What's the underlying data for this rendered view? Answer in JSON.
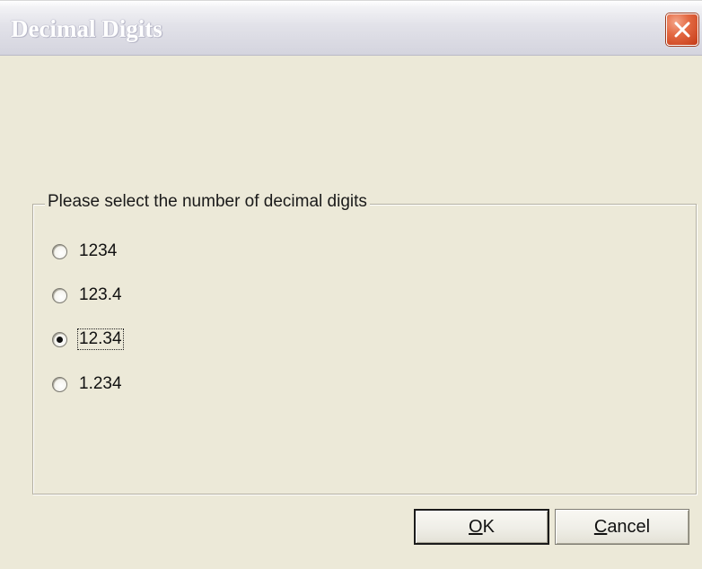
{
  "window": {
    "title": "Decimal Digits"
  },
  "group": {
    "legend": "Please select the number of decimal digits"
  },
  "options": [
    {
      "label": "1234",
      "checked": false
    },
    {
      "label": "123.4",
      "checked": false
    },
    {
      "label": "12.34",
      "checked": true
    },
    {
      "label": "1.234",
      "checked": false
    }
  ],
  "buttons": {
    "ok_mnemonic": "O",
    "ok_rest": "K",
    "cancel_mnemonic": "C",
    "cancel_rest": "ancel"
  },
  "icons": {
    "close": "close-icon",
    "radio": "radio-icon"
  },
  "colors": {
    "dialog_background": "#ece9d8",
    "close_button": "#e46a44"
  }
}
